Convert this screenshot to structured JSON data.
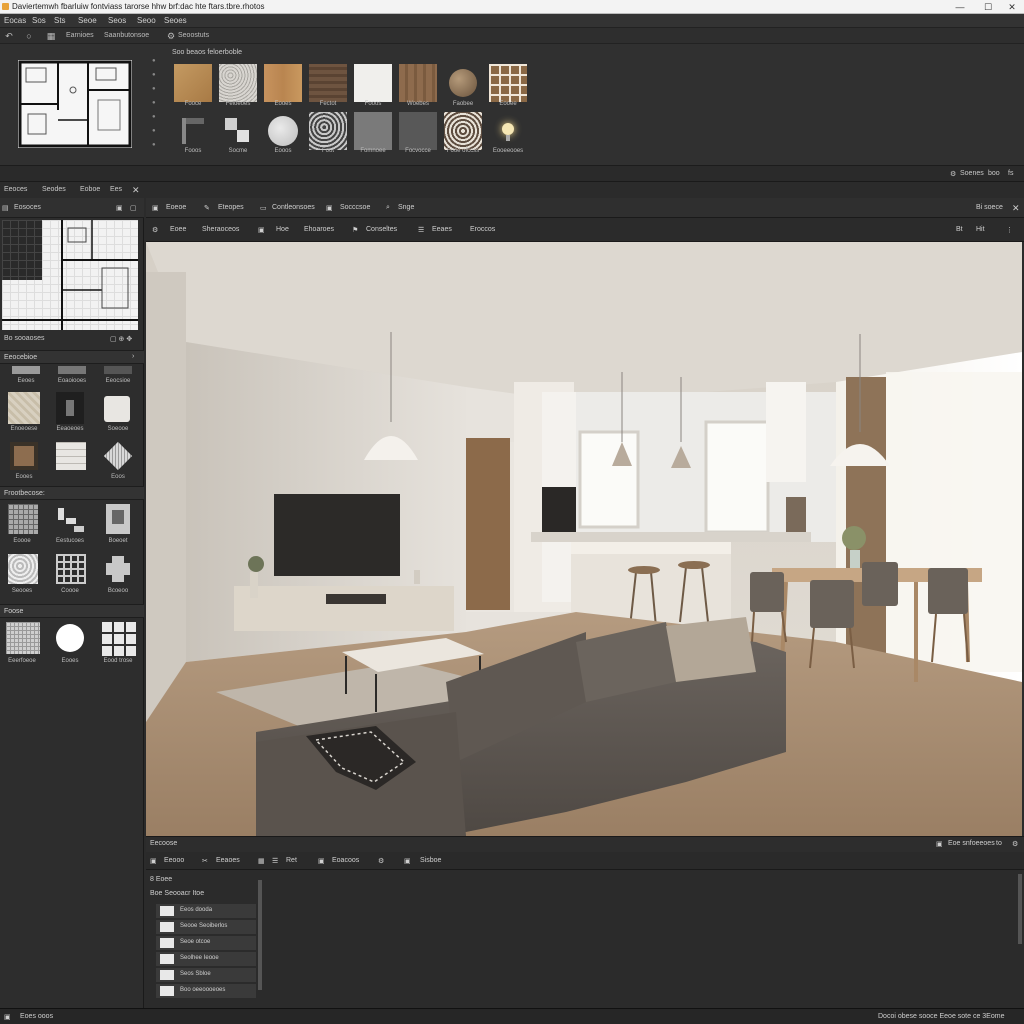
{
  "window": {
    "title": "Daviertemwh fbarluiw fontviass tarorse hhw brf:dac hte ftars.tbre.rhotos",
    "minimize": "—",
    "maximize": "☐",
    "close": "✕"
  },
  "menu": [
    "Eocas",
    "Sos",
    "Sts",
    "Seoe",
    "Seos",
    "Seoo",
    "Seoes"
  ],
  "toolbar": {
    "label1": "Earnioes",
    "label2": "Saanbutonsoe",
    "label3": "Seoostuts"
  },
  "library": {
    "header": "Soo beaos feloerboble",
    "row1": [
      "Fooce",
      "Feioeoes",
      "Eooes",
      "Fectot",
      "Fooos",
      "Woebes",
      "Faobee",
      "Eooee"
    ],
    "row2": [
      "Fooos",
      "Socme",
      "Eooos",
      "Foot",
      "Fomnoee",
      "Focvocce",
      "Fooe ofccss",
      "Eooeeooes"
    ],
    "colors": {
      "wood": "#b7895a",
      "granite": "#c9c6c0",
      "oak": "#c4935f",
      "darkwood": "#6e5440",
      "white": "#f2f2f0",
      "brown": "#8e6b4d"
    }
  },
  "status_strip": {
    "right": "Soenes",
    "right2": "boo",
    "right3": "fs"
  },
  "left_tabs": [
    "Eeoces",
    "Seodes",
    "Eoboe",
    "Ees"
  ],
  "left_panel": {
    "header": "Eosoces",
    "floorplan_footer": "Bo sooaoses",
    "sec1_title": "Eeocebioe",
    "sec1_row0": [
      "Eeoes",
      "Eoaoiooes",
      "Eeocsioe"
    ],
    "sec1_row1": [
      "Enoeoese",
      "Eeaoeoes",
      "Soeooe"
    ],
    "sec1_row2": [
      "Eooes",
      "",
      "Eoos"
    ],
    "sec2_title": "Frootbecose:",
    "sec2_row1": [
      "Eoooe",
      "Eestucoes",
      "Boeoet"
    ],
    "sec2_row2": [
      "Seooes",
      "Coooe",
      "Bcoeoo"
    ],
    "sec3_title": "Foose",
    "sec3_row": [
      "Eeerfoeoe",
      "Eooes",
      "Eood trose"
    ]
  },
  "viewport": {
    "header_items": [
      "Eoeoe",
      "Eteopes",
      "Contleonsoes",
      "Socccsoe",
      "Snge"
    ],
    "header_right": "Bi soece",
    "bar_items": [
      "Eoee",
      "Sheraoceos",
      "Hoe",
      "Ehoaroes",
      "Conseltes",
      "Eeaes",
      "Eroccos"
    ],
    "bar_right": [
      "Bt",
      "Hit"
    ]
  },
  "bottom": {
    "header": "Eecoose",
    "header_right": "Eoe snfoeeoes",
    "header_right2": "to",
    "bar_items": [
      "Eeooo",
      "Eeaoes",
      "Ret",
      "Eoacoos",
      "Sisboe"
    ],
    "tree_top": "8 Eoee",
    "tree_top2": "Boe Seooacr Itoe",
    "tree": [
      "Eeos dooda",
      "Seooe Seoiberlos",
      "Seoe otcoe",
      "Seolhee Ieooe",
      "Seos Sbloe",
      "Boo oeeoooeoes"
    ]
  },
  "statusbar": {
    "left": "Eoes ooos",
    "right": "Docoi obese sooce Eeoe sote ce 3Eome"
  }
}
